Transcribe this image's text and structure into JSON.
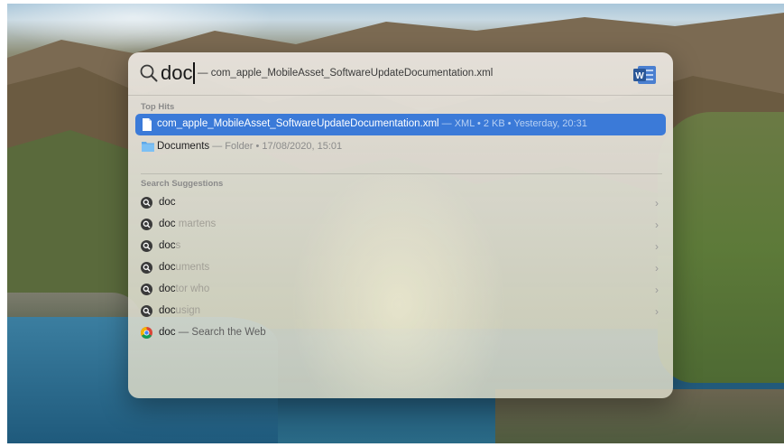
{
  "search": {
    "query": "doc",
    "completion": "— com_apple_MobileAsset_SoftwareUpdateDocumentation.xml"
  },
  "top_hits": {
    "title": "Top Hits",
    "items": [
      {
        "name": "com_apple_MobileAsset_SoftwareUpdateDocumentation.xml",
        "meta": " — XML • 2 KB • Yesterday, 20:31",
        "icon": "document-icon",
        "selected": true
      },
      {
        "name": "Documents",
        "meta": " — Folder • 17/08/2020, 15:01",
        "icon": "folder-icon",
        "selected": false
      }
    ]
  },
  "suggestions": {
    "title": "Search Suggestions",
    "items": [
      {
        "typed": "doc",
        "rest": "",
        "icon": "search-suggestion-icon"
      },
      {
        "typed": "doc",
        "rest": " martens",
        "icon": "search-suggestion-icon"
      },
      {
        "typed": "doc",
        "rest": "s",
        "icon": "search-suggestion-icon"
      },
      {
        "typed": "doc",
        "rest": "uments",
        "icon": "search-suggestion-icon"
      },
      {
        "typed": "doc",
        "rest": "tor who",
        "icon": "search-suggestion-icon"
      },
      {
        "typed": "doc",
        "rest": "usign",
        "icon": "search-suggestion-icon"
      }
    ],
    "web": {
      "typed": "doc",
      "rest": " — Search the Web",
      "icon": "chrome-icon"
    }
  },
  "colors": {
    "selection": "#3b7ad8",
    "word": "#2b5797"
  }
}
